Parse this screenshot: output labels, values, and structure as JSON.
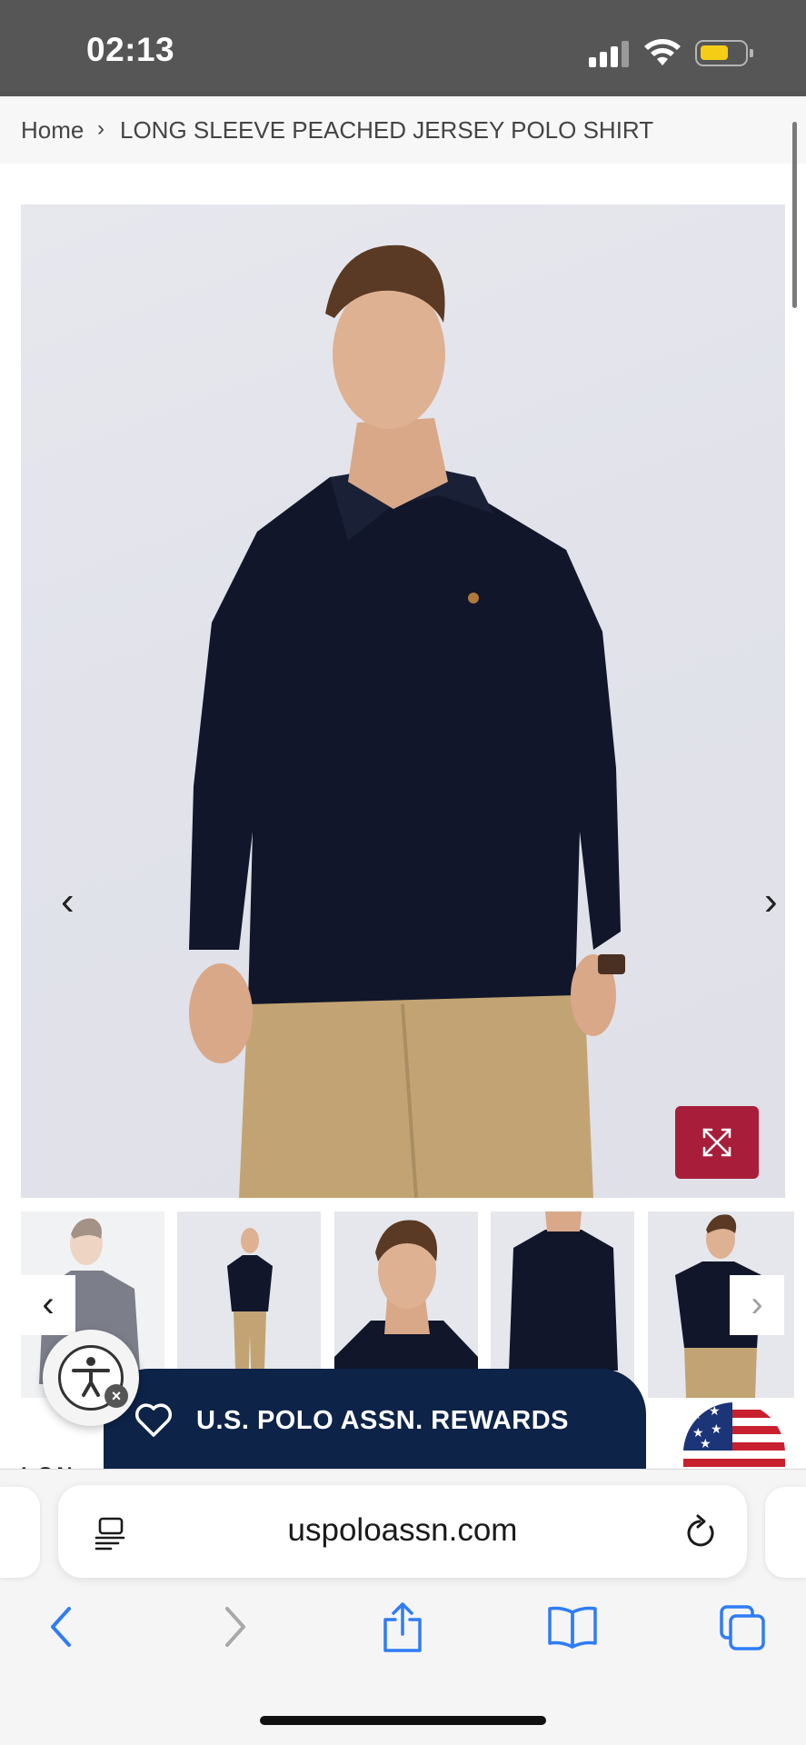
{
  "status_bar": {
    "time": "02:13"
  },
  "breadcrumb": {
    "home": "Home",
    "separator": "›",
    "current": "LONG SLEEVE PEACHED JERSEY POLO SHIRT"
  },
  "gallery": {
    "prev_arrow": "‹",
    "next_arrow": "›",
    "thumbnail_count": 5
  },
  "thumbnails": {
    "prev_arrow": "‹",
    "next_arrow": "›"
  },
  "rewards": {
    "label": "U.S. POLO ASSN. REWARDS"
  },
  "page_peek": {
    "text": "LON"
  },
  "browser": {
    "url": "uspoloassn.com"
  },
  "colors": {
    "status_bar": "#565656",
    "accent_red": "#a81e3a",
    "navy": "#0d2348",
    "ios_blue": "#2f7cf6",
    "battery": "#f5cc16"
  },
  "icons": [
    "cellular-icon",
    "wifi-icon",
    "battery-icon",
    "expand-icon",
    "heart-icon",
    "accessibility-icon",
    "flag-icon",
    "reader-icon",
    "reload-icon",
    "back-icon",
    "forward-icon",
    "share-icon",
    "bookmarks-icon",
    "tabs-icon"
  ]
}
